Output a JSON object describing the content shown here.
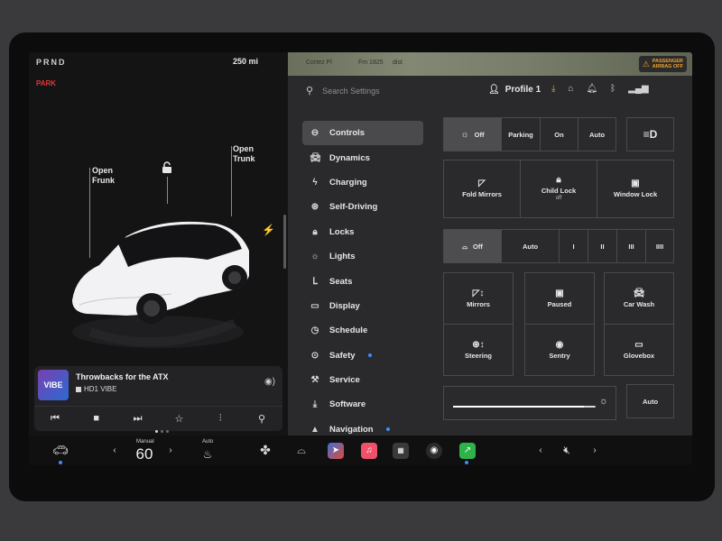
{
  "left": {
    "gear": "PRND",
    "park": "PARK",
    "range": "250 mi",
    "frunk": {
      "line1": "Open",
      "line2": "Frunk"
    },
    "trunk": {
      "line1": "Open",
      "line2": "Trunk"
    }
  },
  "media": {
    "logo": "VIBE",
    "track": "Throwbacks for the ATX",
    "station": "HD1 VIBE"
  },
  "map": {
    "airbag_line1": "PASSENGER",
    "airbag_line2": "AIRBAG OFF",
    "label1": "Cortez Pl",
    "label2": "Fm 1825",
    "label3": "dist"
  },
  "topbar": {
    "search_placeholder": "Search Settings",
    "profile": "Profile 1"
  },
  "menu": [
    {
      "label": "Controls",
      "icon": "toggle-icon",
      "dot": false
    },
    {
      "label": "Dynamics",
      "icon": "car-icon",
      "dot": false
    },
    {
      "label": "Charging",
      "icon": "bolt-icon",
      "dot": false
    },
    {
      "label": "Self-Driving",
      "icon": "steering-wheel-icon",
      "dot": false
    },
    {
      "label": "Locks",
      "icon": "lock-icon",
      "dot": false
    },
    {
      "label": "Lights",
      "icon": "sun-icon",
      "dot": false
    },
    {
      "label": "Seats",
      "icon": "seat-icon",
      "dot": false
    },
    {
      "label": "Display",
      "icon": "display-icon",
      "dot": false
    },
    {
      "label": "Schedule",
      "icon": "clock-icon",
      "dot": false
    },
    {
      "label": "Safety",
      "icon": "shield-icon",
      "dot": true
    },
    {
      "label": "Service",
      "icon": "wrench-icon",
      "dot": false
    },
    {
      "label": "Software",
      "icon": "download-icon",
      "dot": false
    },
    {
      "label": "Navigation",
      "icon": "navigation-icon",
      "dot": true
    }
  ],
  "controls": {
    "lights": {
      "off": "Off",
      "parking": "Parking",
      "on": "On",
      "auto": "Auto"
    },
    "fold_mirrors": "Fold Mirrors",
    "child_lock": "Child Lock",
    "child_lock_state": "off",
    "window_lock": "Window Lock",
    "wipers": {
      "off": "Off",
      "auto": "Auto",
      "s1": "I",
      "s2": "II",
      "s3": "III",
      "s4": "IIII"
    },
    "mirrors": "Mirrors",
    "paused": "Paused",
    "car_wash": "Car Wash",
    "steering": "Steering",
    "sentry": "Sentry",
    "glovebox": "Glovebox",
    "brightness_auto": "Auto",
    "brightness_level": 0.92
  },
  "dock": {
    "temp_mode": "Manual",
    "temp": "60",
    "seat_heat_mode": "Auto"
  }
}
